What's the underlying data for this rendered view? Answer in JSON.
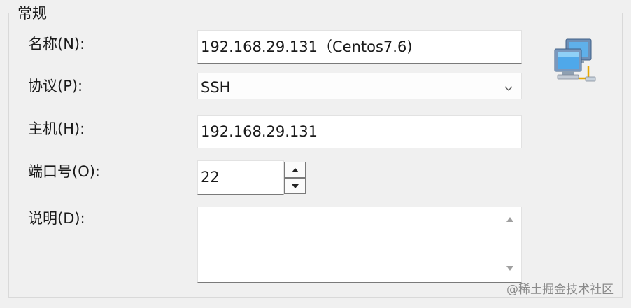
{
  "group": {
    "title": "常规"
  },
  "form": {
    "name": {
      "label": "名称(N):",
      "value": "192.168.29.131（Centos7.6)"
    },
    "protocol": {
      "label": "协议(P):",
      "value": "SSH"
    },
    "host": {
      "label": "主机(H):",
      "value": "192.168.29.131"
    },
    "port": {
      "label": "端口号(O):",
      "value": "22"
    },
    "description": {
      "label": "说明(D):",
      "value": ""
    }
  },
  "icons": {
    "computer": "network-computers-icon",
    "dropdown": "chevron-down-icon",
    "spin_up": "arrow-up-icon",
    "spin_down": "arrow-down-icon"
  },
  "watermark": "@稀土掘金技术社区"
}
